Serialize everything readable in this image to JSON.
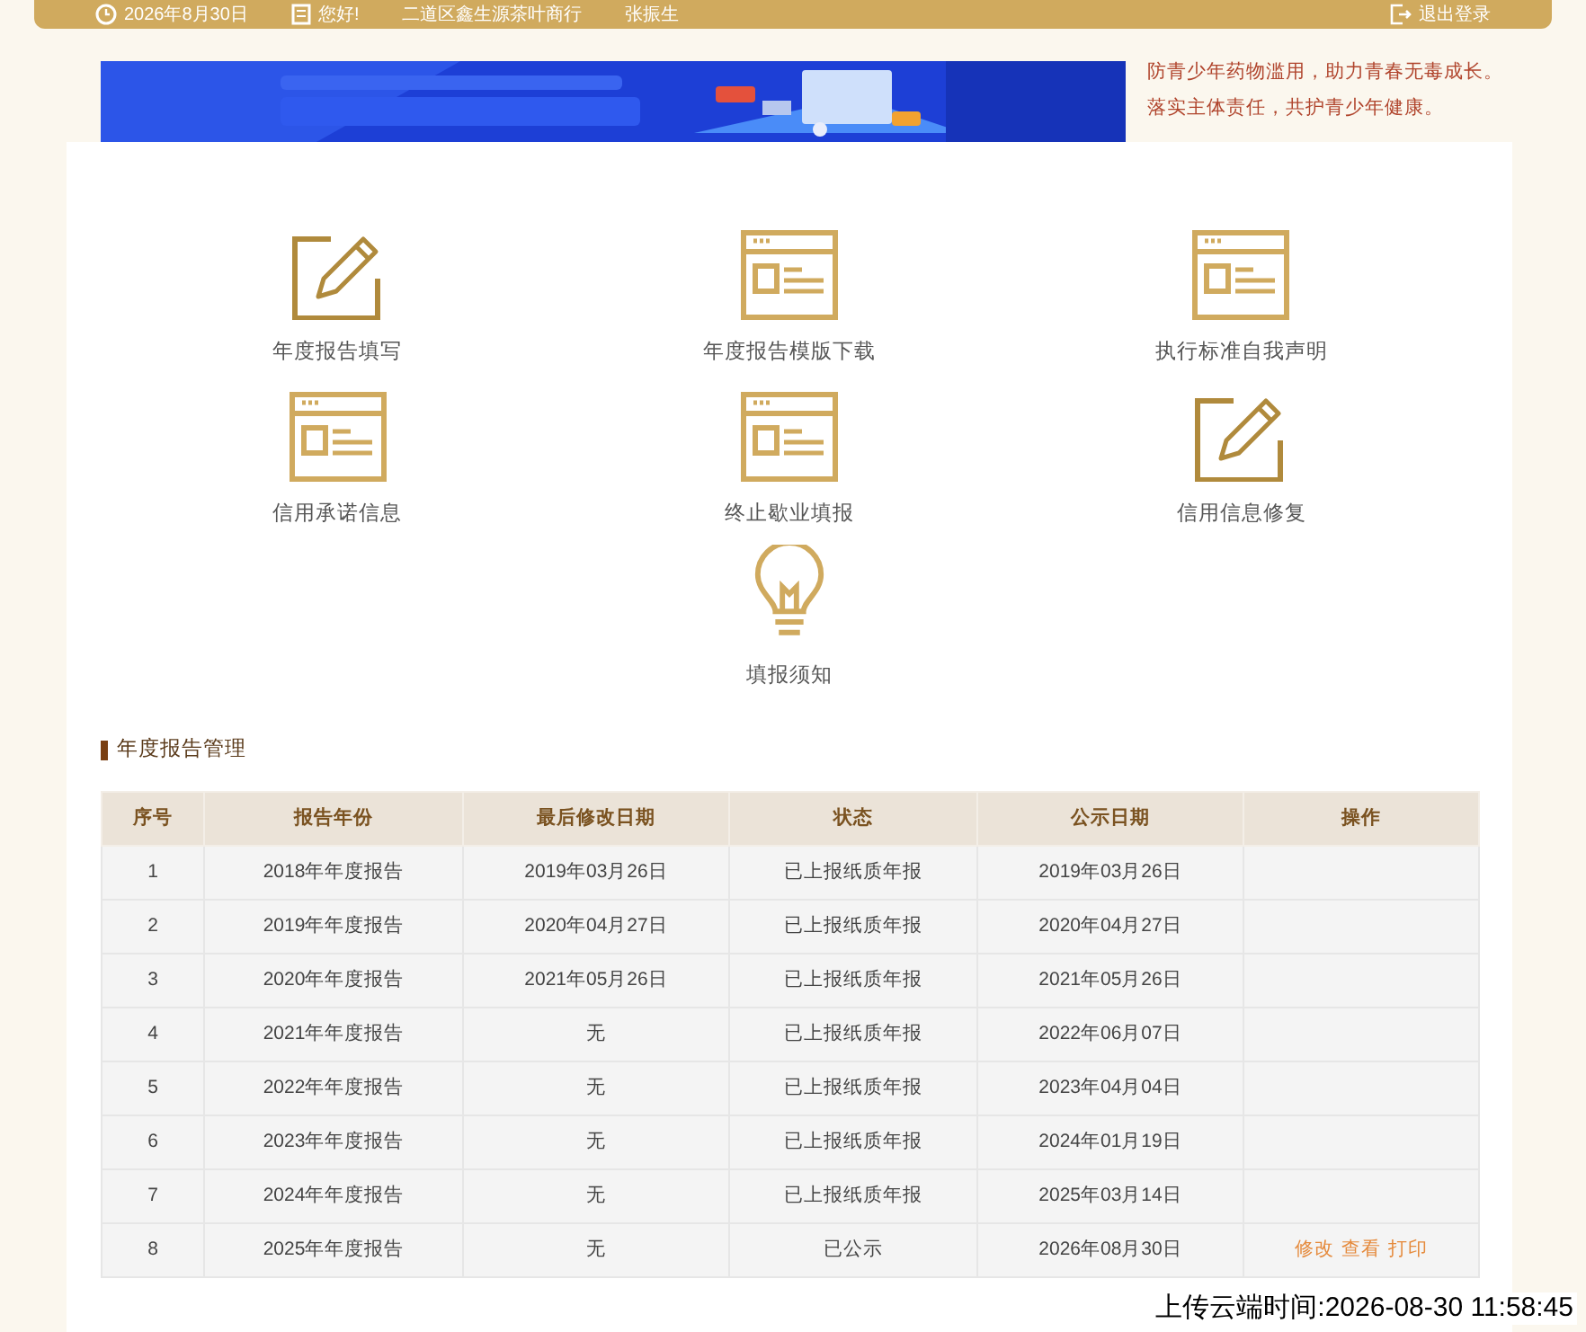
{
  "top_bar": {
    "date": "2026年8月30日",
    "greeting": "您好!",
    "company": "二道区鑫生源茶叶商行",
    "user": "张振生",
    "logout": "退出登录"
  },
  "notice": [
    "防青少年药物滥用，助力青春无毒成长。",
    "落实主体责任，共护青少年健康。"
  ],
  "banner": {
    "kind": "picture"
  },
  "menu": [
    {
      "label": "年度报告填写",
      "kind": "edit"
    },
    {
      "label": "年度报告模版下载",
      "kind": "form"
    },
    {
      "label": "执行标准自我声明",
      "kind": "form"
    },
    {
      "label": "信用承诺信息",
      "kind": "form"
    },
    {
      "label": "终止歇业填报",
      "kind": "form"
    },
    {
      "label": "信用信息修复",
      "kind": "edit"
    },
    {
      "label": "填报须知",
      "kind": "bulb"
    }
  ],
  "section_title": "年度报告管理",
  "table": {
    "columns": [
      "序号",
      "报告年份",
      "最后修改日期",
      "状态",
      "公示日期",
      "操作"
    ],
    "rows": [
      {
        "cells": [
          "1",
          "2018年年度报告",
          "2019年03月26日",
          "已上报纸质年报",
          "2019年03月26日"
        ],
        "actions": []
      },
      {
        "cells": [
          "2",
          "2019年年度报告",
          "2020年04月27日",
          "已上报纸质年报",
          "2020年04月27日"
        ],
        "actions": []
      },
      {
        "cells": [
          "3",
          "2020年年度报告",
          "2021年05月26日",
          "已上报纸质年报",
          "2021年05月26日"
        ],
        "actions": []
      },
      {
        "cells": [
          "4",
          "2021年年度报告",
          "无",
          "已上报纸质年报",
          "2022年06月07日"
        ],
        "actions": []
      },
      {
        "cells": [
          "5",
          "2022年年度报告",
          "无",
          "已上报纸质年报",
          "2023年04月04日"
        ],
        "actions": []
      },
      {
        "cells": [
          "6",
          "2023年年度报告",
          "无",
          "已上报纸质年报",
          "2024年01月19日"
        ],
        "actions": []
      },
      {
        "cells": [
          "7",
          "2024年年度报告",
          "无",
          "已上报纸质年报",
          "2025年03月14日"
        ],
        "actions": []
      },
      {
        "cells": [
          "8",
          "2025年年度报告",
          "无",
          "已公示",
          "2026年08月30日"
        ],
        "actions": [
          "修改",
          "查看",
          "打印"
        ]
      }
    ]
  },
  "upload_time": "上传云端时间:2026-08-30 11:58:45"
}
